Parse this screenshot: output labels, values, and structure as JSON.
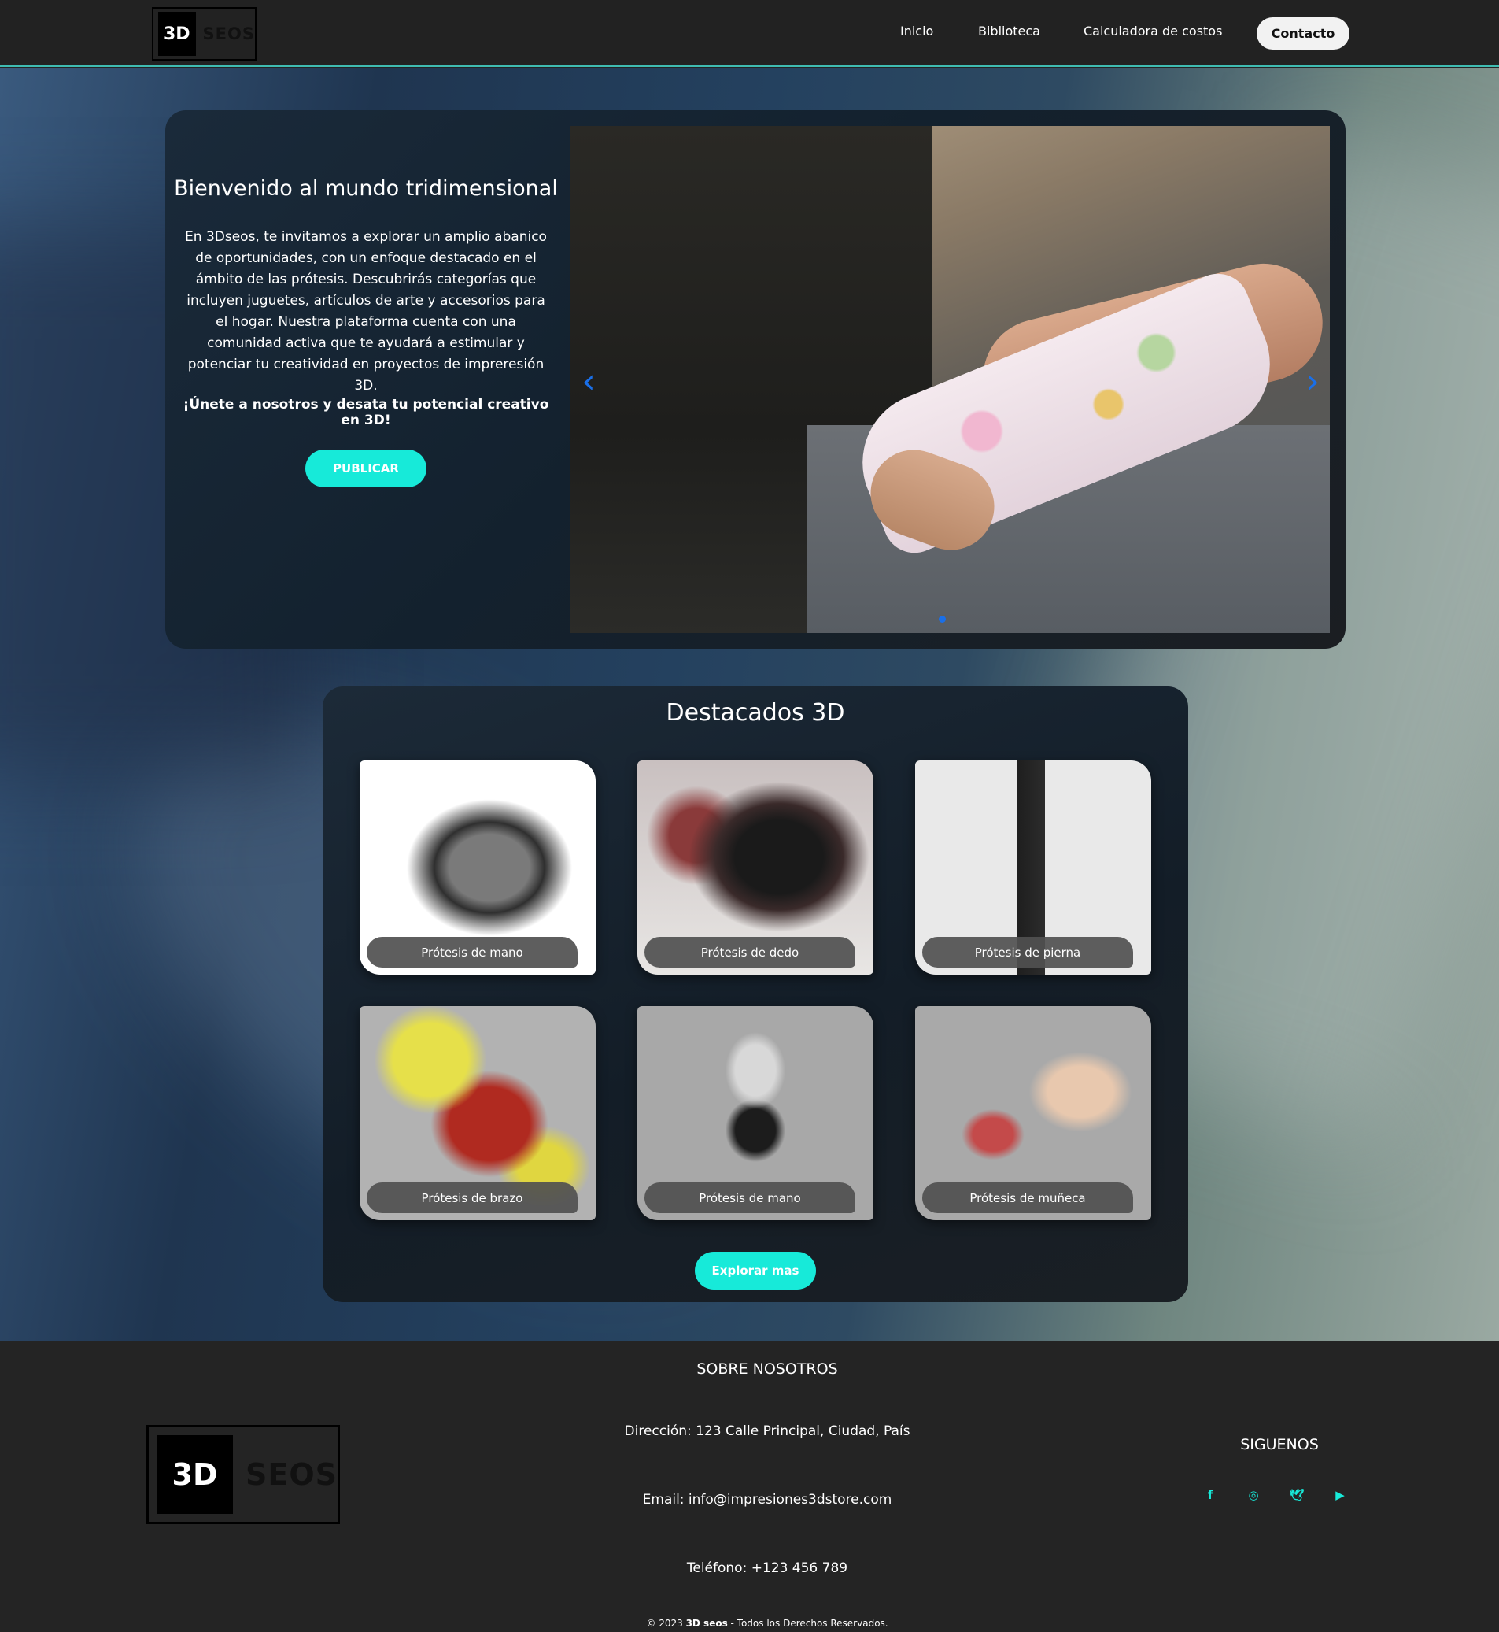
{
  "header": {
    "logo": {
      "left": "3D",
      "right": "SEOS"
    },
    "nav": [
      "Inicio",
      "Biblioteca",
      "Calculadora de costos"
    ],
    "contact_label": "Contacto"
  },
  "welcome": {
    "title": "Bienvenido al mundo tridimensional",
    "paragraph": "En 3Dseos, te invitamos a explorar un amplio abanico de oportunidades, con un enfoque destacado en el ámbito de las prótesis. Descubrirás categorías que incluyen juguetes, artículos de arte y accesorios para el hogar. Nuestra plataforma cuenta con una comunidad activa que te ayudará a estimular y potenciar tu creatividad en proyectos de impreresión 3D.",
    "cta": "¡Únete a nosotros y desata tu potencial creativo en 3D!",
    "publish_label": "PUBLICAR"
  },
  "featured": {
    "title": "Destacados 3D",
    "cards": [
      {
        "label": "Prótesis de mano"
      },
      {
        "label": "Prótesis de dedo"
      },
      {
        "label": "Prótesis de pierna"
      },
      {
        "label": "Prótesis de brazo"
      },
      {
        "label": "Prótesis de mano"
      },
      {
        "label": "Prótesis de muñeca"
      }
    ],
    "explore_label": "Explorar mas"
  },
  "footer": {
    "about_title": "SOBRE NOSOTROS",
    "address": "Dirección: 123 Calle Principal, Ciudad, País",
    "email": "Email: info@impresiones3dstore.com",
    "phone": "Teléfono: +123 456 789",
    "follow_title": "SIGUENOS",
    "socials": [
      "facebook-icon",
      "instagram-icon",
      "twitter-icon",
      "youtube-icon"
    ],
    "copyright_prefix": "© 2023 ",
    "copyright_brand": "3D seos",
    "copyright_suffix": " - Todos los Derechos Reservados."
  },
  "colors": {
    "accent": "#17ead9",
    "header_bg": "#222222",
    "carousel_control": "#1a6fe8"
  }
}
